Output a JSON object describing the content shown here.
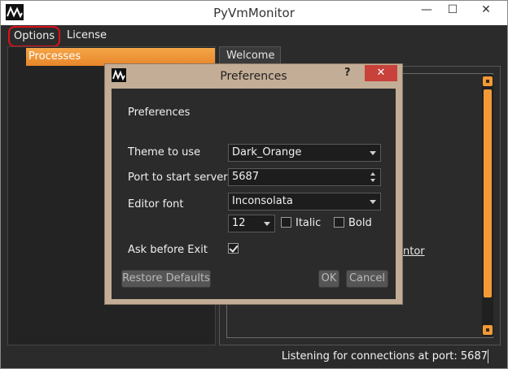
{
  "window": {
    "title": "PyVmMonitor",
    "controls": {
      "minimize": "—",
      "maximize": "☐",
      "close": "✕"
    }
  },
  "menubar": {
    "items": [
      {
        "label": "Options",
        "highlighted": true
      },
      {
        "label": "License"
      }
    ]
  },
  "left_panel": {
    "header": "Processes"
  },
  "tabs": [
    {
      "label": "Welcome"
    }
  ],
  "welcome": {
    "link_fragment": "ntor"
  },
  "statusbar": {
    "text": "Listening for connections at port: 5687"
  },
  "dialog": {
    "title": "Preferences",
    "help": "?",
    "close": "✕",
    "heading": "Preferences",
    "theme": {
      "label": "Theme to use",
      "value": "Dark_Orange"
    },
    "port": {
      "label": "Port to start server",
      "value": "5687"
    },
    "editor_font": {
      "label": "Editor font",
      "value": "Inconsolata",
      "size": "12",
      "italic_label": "Italic",
      "italic": false,
      "bold_label": "Bold",
      "bold": false
    },
    "ask_before_exit": {
      "label": "Ask before Exit",
      "checked": true
    },
    "buttons": {
      "restore": "Restore Defaults",
      "ok": "OK",
      "cancel": "Cancel"
    }
  },
  "colors": {
    "accent": "#f29a38",
    "dialog_frame": "#c4ad96",
    "background": "#2b2b2b",
    "close_red": "#c8413a",
    "highlight_ring": "#e0101a"
  },
  "icons": {
    "app": "waveform-icon",
    "combo": "chevron-down-icon"
  }
}
